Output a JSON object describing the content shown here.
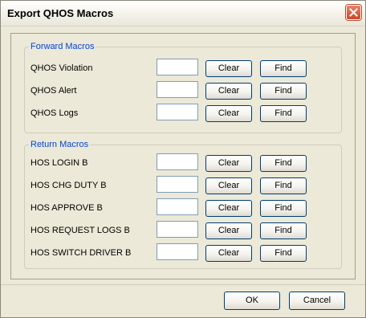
{
  "window": {
    "title": "Export QHOS Macros"
  },
  "forward": {
    "legend": "Forward Macros",
    "rows": [
      {
        "label": "QHOS Violation",
        "value": "",
        "clear": "Clear",
        "find": "Find"
      },
      {
        "label": "QHOS Alert",
        "value": "",
        "clear": "Clear",
        "find": "Find"
      },
      {
        "label": "QHOS Logs",
        "value": "",
        "clear": "Clear",
        "find": "Find"
      }
    ]
  },
  "return": {
    "legend": "Return Macros",
    "rows": [
      {
        "label": "HOS LOGIN B",
        "value": "",
        "clear": "Clear",
        "find": "Find"
      },
      {
        "label": "HOS CHG DUTY B",
        "value": "",
        "clear": "Clear",
        "find": "Find"
      },
      {
        "label": "HOS APPROVE B",
        "value": "",
        "clear": "Clear",
        "find": "Find"
      },
      {
        "label": "HOS REQUEST LOGS B",
        "value": "",
        "clear": "Clear",
        "find": "Find"
      },
      {
        "label": "HOS SWITCH DRIVER B",
        "value": "",
        "clear": "Clear",
        "find": "Find"
      }
    ]
  },
  "footer": {
    "ok_label": "OK",
    "cancel_label": "Cancel"
  },
  "icons": {
    "close": "close-icon"
  },
  "colors": {
    "legend": "#0046d5",
    "close_button": "#c64a2c",
    "field_border": "#7f9db9",
    "button_border": "#003c74"
  }
}
